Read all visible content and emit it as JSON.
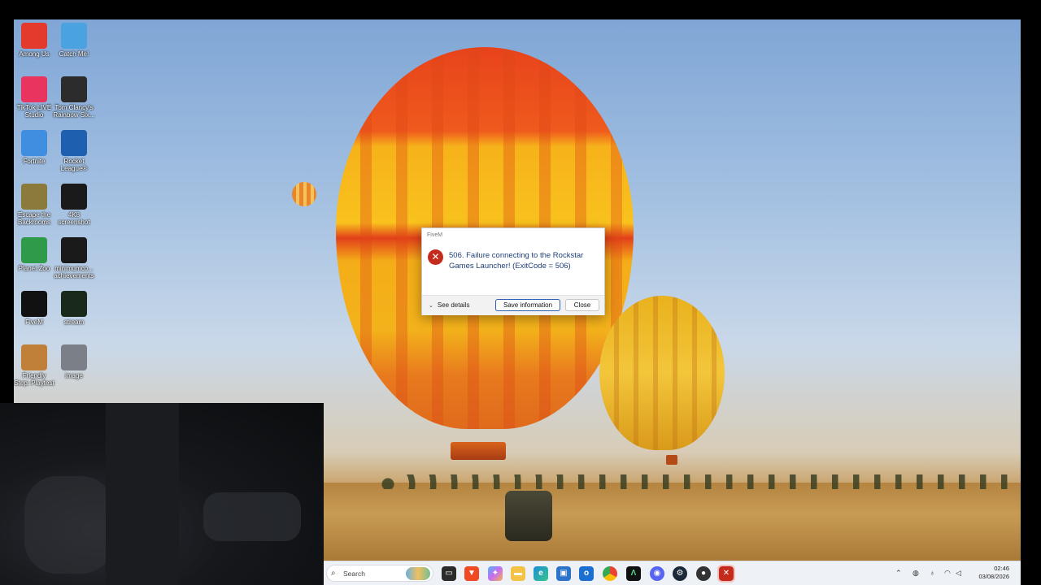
{
  "desktop": {
    "icons": [
      {
        "label": "Among Us",
        "icon": "among-us-icon",
        "color": "#e23b2e"
      },
      {
        "label": "Catch Me!",
        "icon": "catch-me-icon",
        "color": "#4aa3e0"
      },
      {
        "label": "TikTok LIVE\nStudio",
        "icon": "tiktok-icon",
        "color": "#e8345e"
      },
      {
        "label": "Tom Clancy's\nRainbow Six...",
        "icon": "rainbow-six-icon",
        "color": "#2c2c2c"
      },
      {
        "label": "Fortnite",
        "icon": "fortnite-icon",
        "color": "#3f8ee0"
      },
      {
        "label": "Rocket\nLeague®",
        "icon": "rocket-league-icon",
        "color": "#1f5fb0"
      },
      {
        "label": "Escape the\nBackrooms",
        "icon": "escape-backrooms-icon",
        "color": "#8a7a3c"
      },
      {
        "label": "4K8\nscreenshot",
        "icon": "screenshot-file-icon",
        "color": "#1a1a1a"
      },
      {
        "label": "Planet Zoo",
        "icon": "planet-zoo-icon",
        "color": "#2f9a4a"
      },
      {
        "label": "minimumco...\nachievements",
        "icon": "achievements-file-icon",
        "color": "#1a1a1a"
      },
      {
        "label": "FiveM",
        "icon": "fivem-icon",
        "color": "#111"
      },
      {
        "label": "stream",
        "icon": "stream-file-icon",
        "color": "#1a2a1a"
      },
      {
        "label": "Friendly\nStep: Playtest",
        "icon": "friendly-step-icon",
        "color": "#c0803a"
      },
      {
        "label": "image",
        "icon": "image-file-icon",
        "color": "#7a7f88"
      }
    ]
  },
  "dialog": {
    "title": "FiveM",
    "message": "506. Failure connecting to the Rockstar Games Launcher! (ExitCode = 506)",
    "details_label": "See details",
    "save_label": "Save information",
    "close_label": "Close",
    "error_color": "#c42b1c"
  },
  "taskbar": {
    "search_placeholder": "Search",
    "apps": [
      "file-explorer-icon",
      "brave-icon",
      "copilot-icon",
      "folder-icon",
      "edge-icon",
      "store-icon",
      "outlook-icon",
      "chrome-icon",
      "fivem-taskbar-icon",
      "discord-icon",
      "steam-icon",
      "app-icon",
      "error-app-icon"
    ],
    "time": "02:46",
    "date": "03/08/2026"
  }
}
